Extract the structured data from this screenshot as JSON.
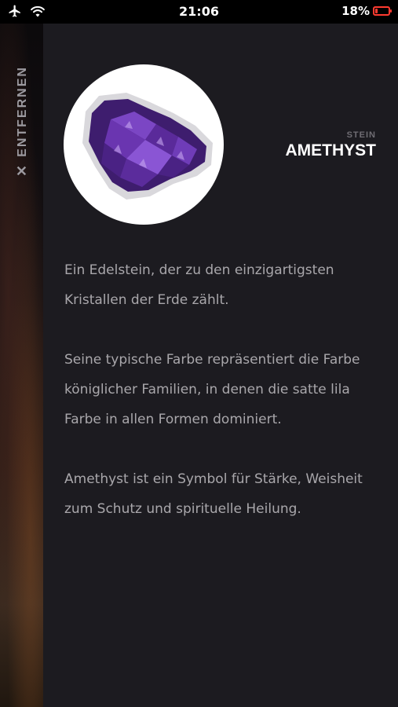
{
  "status_bar": {
    "time": "21:06",
    "battery_percent": "18%",
    "battery_level": 0.18
  },
  "sidebar": {
    "remove_label": "ENTFERNEN"
  },
  "stone": {
    "type_label": "STEIN",
    "name": "AMETHYST",
    "paragraphs": [
      "Ein Edelstein, der zu den einzigartigsten Kristallen der Erde zählt.",
      "Seine typische Farbe repräsentiert die Farbe königlicher Familien, in denen die satte lila Farbe in allen Formen dominiert.",
      "Amethyst ist ein Symbol für Stärke, Weisheit zum Schutz und spirituelle Heilung."
    ]
  },
  "colors": {
    "panel_bg": "#1c1b20",
    "text_secondary": "#a9a7ab",
    "amethyst": "#5a2a9a",
    "battery_low": "#ff3b30"
  }
}
